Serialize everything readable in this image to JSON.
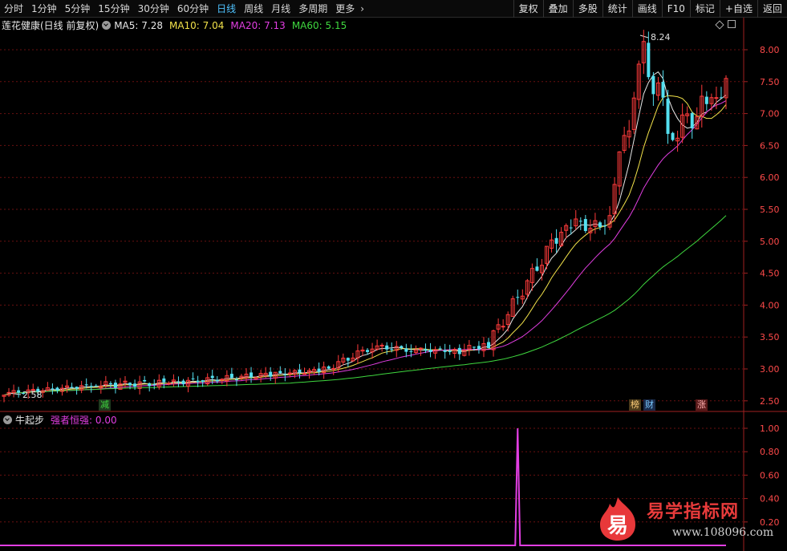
{
  "toolbar": {
    "periods": [
      "分时",
      "1分钟",
      "5分钟",
      "15分钟",
      "30分钟",
      "60分钟",
      "日线",
      "周线",
      "月线",
      "多周期",
      "更多"
    ],
    "active_period": "日线",
    "more_arrow": "›",
    "buttons": [
      "复权",
      "叠加",
      "多股",
      "统计",
      "画线",
      "F10",
      "标记",
      "+自选",
      "返回"
    ]
  },
  "main_chart": {
    "stock_title": "莲花健康(日线 前复权)",
    "ma": [
      {
        "label": "MA5: 7.28",
        "color": "#e8e8e8"
      },
      {
        "label": "MA10: 7.04",
        "color": "#f2e24a"
      },
      {
        "label": "MA20: 7.13",
        "color": "#e23ee2"
      },
      {
        "label": "MA60: 5.15",
        "color": "#3fd83f"
      }
    ],
    "y_ticks": [
      "8.00",
      "7.50",
      "7.00",
      "6.50",
      "6.00",
      "5.50",
      "5.00",
      "4.50",
      "4.00",
      "3.50",
      "3.00",
      "2.50"
    ],
    "peak_label": "8.24",
    "low_label": "2.58",
    "markers": {
      "jian": "减",
      "bang": "榜",
      "cai": "财",
      "zhang": "涨"
    },
    "up_color": "#ff3b3b",
    "down_color": "#54e0f0"
  },
  "sub_chart": {
    "indicator": "牛起步",
    "value_label": "强者恒强: 0.00",
    "y_ticks": [
      "1.00",
      "0.80",
      "0.60",
      "0.40",
      "0.20"
    ],
    "line_color": "#e23ee2"
  },
  "watermark": {
    "logo_char": "易",
    "brand": "易学指标网",
    "url": "www.108096.com"
  }
}
